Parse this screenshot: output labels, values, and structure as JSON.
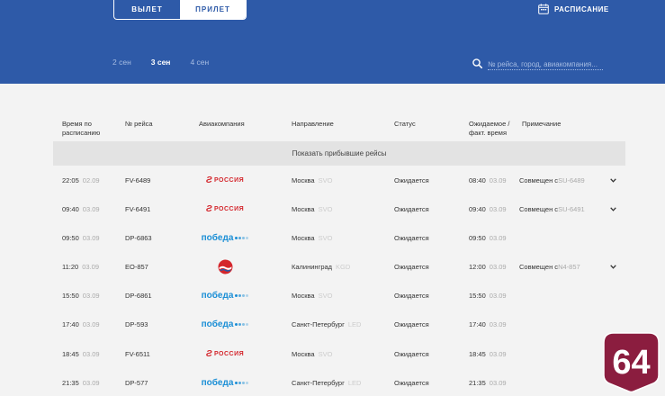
{
  "toggle": {
    "departure": "ВЫЛЕТ",
    "arrival": "ПРИЛЕТ"
  },
  "schedule": {
    "label": "РАСПИСАНИЕ",
    "icon": "calendar-icon"
  },
  "dates": [
    "2 сен",
    "3 сен",
    "4 сен"
  ],
  "active_date": "3 сен",
  "search": {
    "placeholder": "№ рейса, город, авиакомпания..."
  },
  "columns": {
    "time": "Время по расписанию",
    "time_line1": "Время по",
    "time_line2": "расписанию",
    "flight": "№ рейса",
    "airline": "Авиакомпания",
    "destination": "Направление",
    "status": "Статус",
    "expected_line1": "Ожидаемое /",
    "expected_line2": "факт. время",
    "note": "Примечание"
  },
  "show_arrived": "Показать прибывшие рейсы",
  "flights": [
    {
      "time": "22:05",
      "date": "02.09",
      "flight": "FV-6489",
      "airline": "rossiya",
      "city": "Москва",
      "code": "SVO",
      "status": "Ожидается",
      "exp_time": "08:40",
      "exp_date": "03.09",
      "note_prefix": "Совмещен с ",
      "note_code": "SU-6489",
      "expand": true
    },
    {
      "time": "09:40",
      "date": "03.09",
      "flight": "FV-6491",
      "airline": "rossiya",
      "city": "Москва",
      "code": "SVO",
      "status": "Ожидается",
      "exp_time": "09:40",
      "exp_date": "03.09",
      "note_prefix": "Совмещен с ",
      "note_code": "SU-6491",
      "expand": true
    },
    {
      "time": "09:50",
      "date": "03.09",
      "flight": "DP-6863",
      "airline": "pobeda",
      "city": "Москва",
      "code": "SVO",
      "status": "Ожидается",
      "exp_time": "09:50",
      "exp_date": "03.09",
      "note_prefix": "",
      "note_code": "",
      "expand": false
    },
    {
      "time": "11:20",
      "date": "03.09",
      "flight": "EO-857",
      "airline": "pegas",
      "city": "Калининград",
      "code": "KGD",
      "status": "Ожидается",
      "exp_time": "12:00",
      "exp_date": "03.09",
      "note_prefix": "Совмещен с ",
      "note_code": "N4-857",
      "expand": true
    },
    {
      "time": "15:50",
      "date": "03.09",
      "flight": "DP-6861",
      "airline": "pobeda",
      "city": "Москва",
      "code": "SVO",
      "status": "Ожидается",
      "exp_time": "15:50",
      "exp_date": "03.09",
      "note_prefix": "",
      "note_code": "",
      "expand": false
    },
    {
      "time": "17:40",
      "date": "03.09",
      "flight": "DP-593",
      "airline": "pobeda",
      "city": "Санкт-Петербург",
      "code": "LED",
      "status": "Ожидается",
      "exp_time": "17:40",
      "exp_date": "03.09",
      "note_prefix": "",
      "note_code": "",
      "expand": false
    },
    {
      "time": "18:45",
      "date": "03.09",
      "flight": "FV-6511",
      "airline": "rossiya",
      "city": "Москва",
      "code": "SVO",
      "status": "Ожидается",
      "exp_time": "18:45",
      "exp_date": "03.09",
      "note_prefix": "",
      "note_code": "",
      "expand": false
    },
    {
      "time": "21:35",
      "date": "03.09",
      "flight": "DP-577",
      "airline": "pobeda",
      "city": "Санкт-Петербург",
      "code": "LED",
      "status": "Ожидается",
      "exp_time": "21:35",
      "exp_date": "03.09",
      "note_prefix": "",
      "note_code": "",
      "expand": false
    }
  ],
  "logos": {
    "rossiya": "РОССИЯ",
    "pobeda": "победа"
  },
  "badge": {
    "text": "64",
    "color": "#8b1d3f"
  },
  "colors": {
    "header": "#2e5aa8",
    "rossiya_red": "#d4262c",
    "pobeda_blue": "#1c8fd6"
  }
}
